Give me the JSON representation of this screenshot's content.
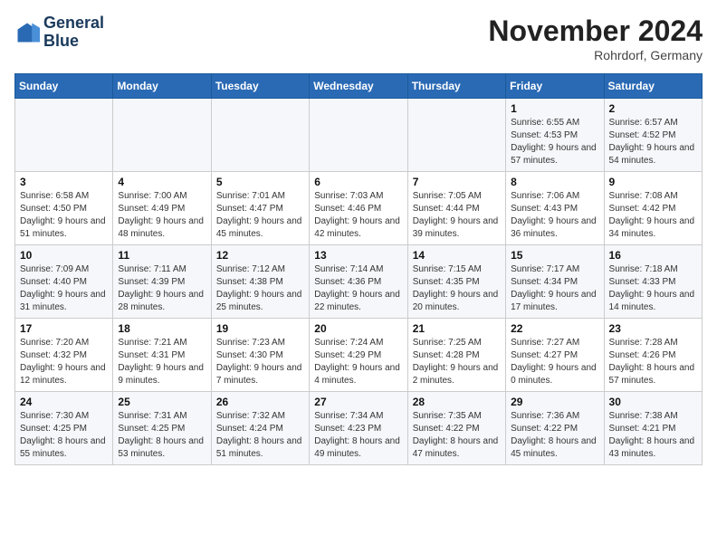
{
  "logo": {
    "line1": "General",
    "line2": "Blue"
  },
  "title": "November 2024",
  "location": "Rohrdorf, Germany",
  "weekdays": [
    "Sunday",
    "Monday",
    "Tuesday",
    "Wednesday",
    "Thursday",
    "Friday",
    "Saturday"
  ],
  "weeks": [
    [
      {
        "day": "",
        "info": ""
      },
      {
        "day": "",
        "info": ""
      },
      {
        "day": "",
        "info": ""
      },
      {
        "day": "",
        "info": ""
      },
      {
        "day": "",
        "info": ""
      },
      {
        "day": "1",
        "info": "Sunrise: 6:55 AM\nSunset: 4:53 PM\nDaylight: 9 hours and 57 minutes."
      },
      {
        "day": "2",
        "info": "Sunrise: 6:57 AM\nSunset: 4:52 PM\nDaylight: 9 hours and 54 minutes."
      }
    ],
    [
      {
        "day": "3",
        "info": "Sunrise: 6:58 AM\nSunset: 4:50 PM\nDaylight: 9 hours and 51 minutes."
      },
      {
        "day": "4",
        "info": "Sunrise: 7:00 AM\nSunset: 4:49 PM\nDaylight: 9 hours and 48 minutes."
      },
      {
        "day": "5",
        "info": "Sunrise: 7:01 AM\nSunset: 4:47 PM\nDaylight: 9 hours and 45 minutes."
      },
      {
        "day": "6",
        "info": "Sunrise: 7:03 AM\nSunset: 4:46 PM\nDaylight: 9 hours and 42 minutes."
      },
      {
        "day": "7",
        "info": "Sunrise: 7:05 AM\nSunset: 4:44 PM\nDaylight: 9 hours and 39 minutes."
      },
      {
        "day": "8",
        "info": "Sunrise: 7:06 AM\nSunset: 4:43 PM\nDaylight: 9 hours and 36 minutes."
      },
      {
        "day": "9",
        "info": "Sunrise: 7:08 AM\nSunset: 4:42 PM\nDaylight: 9 hours and 34 minutes."
      }
    ],
    [
      {
        "day": "10",
        "info": "Sunrise: 7:09 AM\nSunset: 4:40 PM\nDaylight: 9 hours and 31 minutes."
      },
      {
        "day": "11",
        "info": "Sunrise: 7:11 AM\nSunset: 4:39 PM\nDaylight: 9 hours and 28 minutes."
      },
      {
        "day": "12",
        "info": "Sunrise: 7:12 AM\nSunset: 4:38 PM\nDaylight: 9 hours and 25 minutes."
      },
      {
        "day": "13",
        "info": "Sunrise: 7:14 AM\nSunset: 4:36 PM\nDaylight: 9 hours and 22 minutes."
      },
      {
        "day": "14",
        "info": "Sunrise: 7:15 AM\nSunset: 4:35 PM\nDaylight: 9 hours and 20 minutes."
      },
      {
        "day": "15",
        "info": "Sunrise: 7:17 AM\nSunset: 4:34 PM\nDaylight: 9 hours and 17 minutes."
      },
      {
        "day": "16",
        "info": "Sunrise: 7:18 AM\nSunset: 4:33 PM\nDaylight: 9 hours and 14 minutes."
      }
    ],
    [
      {
        "day": "17",
        "info": "Sunrise: 7:20 AM\nSunset: 4:32 PM\nDaylight: 9 hours and 12 minutes."
      },
      {
        "day": "18",
        "info": "Sunrise: 7:21 AM\nSunset: 4:31 PM\nDaylight: 9 hours and 9 minutes."
      },
      {
        "day": "19",
        "info": "Sunrise: 7:23 AM\nSunset: 4:30 PM\nDaylight: 9 hours and 7 minutes."
      },
      {
        "day": "20",
        "info": "Sunrise: 7:24 AM\nSunset: 4:29 PM\nDaylight: 9 hours and 4 minutes."
      },
      {
        "day": "21",
        "info": "Sunrise: 7:25 AM\nSunset: 4:28 PM\nDaylight: 9 hours and 2 minutes."
      },
      {
        "day": "22",
        "info": "Sunrise: 7:27 AM\nSunset: 4:27 PM\nDaylight: 9 hours and 0 minutes."
      },
      {
        "day": "23",
        "info": "Sunrise: 7:28 AM\nSunset: 4:26 PM\nDaylight: 8 hours and 57 minutes."
      }
    ],
    [
      {
        "day": "24",
        "info": "Sunrise: 7:30 AM\nSunset: 4:25 PM\nDaylight: 8 hours and 55 minutes."
      },
      {
        "day": "25",
        "info": "Sunrise: 7:31 AM\nSunset: 4:25 PM\nDaylight: 8 hours and 53 minutes."
      },
      {
        "day": "26",
        "info": "Sunrise: 7:32 AM\nSunset: 4:24 PM\nDaylight: 8 hours and 51 minutes."
      },
      {
        "day": "27",
        "info": "Sunrise: 7:34 AM\nSunset: 4:23 PM\nDaylight: 8 hours and 49 minutes."
      },
      {
        "day": "28",
        "info": "Sunrise: 7:35 AM\nSunset: 4:22 PM\nDaylight: 8 hours and 47 minutes."
      },
      {
        "day": "29",
        "info": "Sunrise: 7:36 AM\nSunset: 4:22 PM\nDaylight: 8 hours and 45 minutes."
      },
      {
        "day": "30",
        "info": "Sunrise: 7:38 AM\nSunset: 4:21 PM\nDaylight: 8 hours and 43 minutes."
      }
    ]
  ]
}
